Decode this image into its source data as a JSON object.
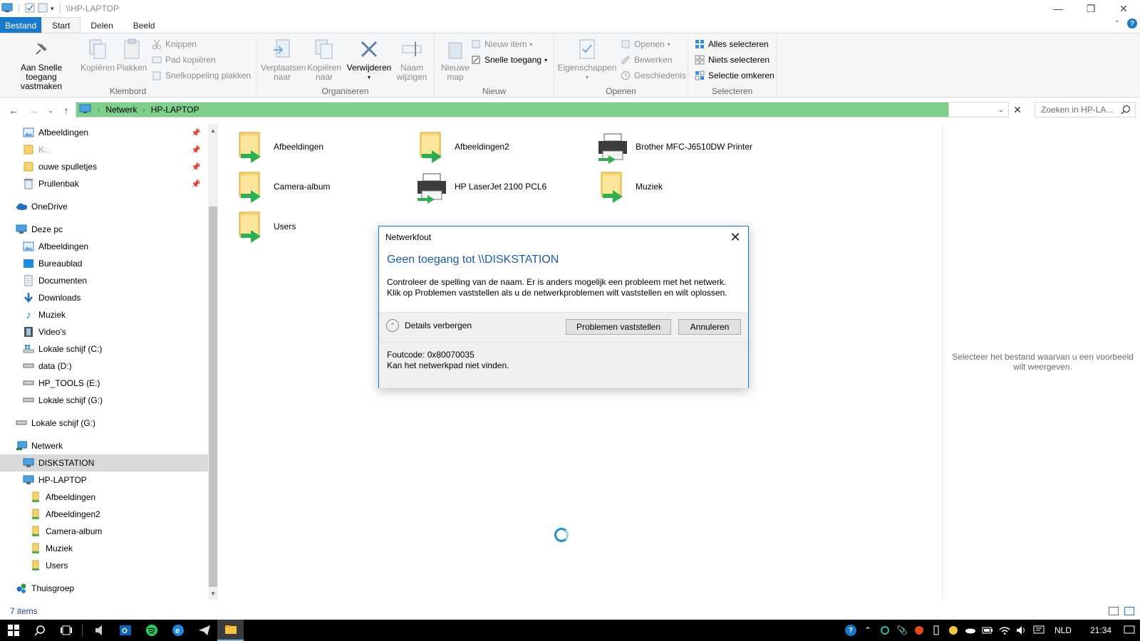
{
  "window": {
    "title": "\\\\HP-LAPTOP"
  },
  "tabs": {
    "file": "Bestand",
    "start": "Start",
    "share": "Delen",
    "view": "Beeld"
  },
  "ribbon": {
    "klembord": {
      "label": "Klembord",
      "pin_line1": "Aan Snelle toegang",
      "pin_line2": "vastmaken",
      "copy": "Kopiëren",
      "paste": "Plakken",
      "cut": "Knippen",
      "copy_path": "Pad kopiëren",
      "paste_shortcut": "Snelkoppeling plakken"
    },
    "organiseren": {
      "label": "Organiseren",
      "move_line1": "Verplaatsen",
      "move_line2": "naar",
      "copyto_line1": "Kopiëren",
      "copyto_line2": "naar",
      "delete": "Verwijderen",
      "rename_line1": "Naam",
      "rename_line2": "wijzigen"
    },
    "nieuw": {
      "label": "Nieuw",
      "newfolder_line1": "Nieuwe",
      "newfolder_line2": "map",
      "new_item": "Nieuw item",
      "easy_access": "Snelle toegang"
    },
    "openen": {
      "label": "Openen",
      "properties": "Eigenschappen",
      "open": "Openen",
      "edit": "Bewerken",
      "history": "Geschiedenis"
    },
    "selecteren": {
      "label": "Selecteren",
      "select_all": "Alles selecteren",
      "select_none": "Niets selecteren",
      "invert": "Selectie omkeren"
    }
  },
  "address": {
    "crumbs": [
      "Netwerk",
      "HP-LAPTOP"
    ],
    "search_placeholder": "Zoeken in HP-LA..."
  },
  "nav": {
    "items": [
      {
        "label": "Afbeeldingen",
        "pinned": true
      },
      {
        "label": "K...",
        "pinned": true
      },
      {
        "label": "ouwe spulletjes",
        "pinned": true
      },
      {
        "label": "Prullenbak",
        "pinned": true
      },
      {
        "label": "OneDrive"
      },
      {
        "label": "Deze pc"
      },
      {
        "label": "Afbeeldingen"
      },
      {
        "label": "Bureaublad"
      },
      {
        "label": "Documenten"
      },
      {
        "label": "Downloads"
      },
      {
        "label": "Muziek"
      },
      {
        "label": "Video's"
      },
      {
        "label": "Lokale schijf (C:)"
      },
      {
        "label": "data (D:)"
      },
      {
        "label": "HP_TOOLS (E:)"
      },
      {
        "label": "Lokale schijf (G:)"
      },
      {
        "label": "Lokale schijf (G:)"
      },
      {
        "label": "Netwerk"
      },
      {
        "label": "DISKSTATION",
        "selected": true
      },
      {
        "label": "HP-LAPTOP"
      },
      {
        "label": "Afbeeldingen"
      },
      {
        "label": "Afbeeldingen2"
      },
      {
        "label": "Camera-album"
      },
      {
        "label": "Muziek"
      },
      {
        "label": "Users"
      },
      {
        "label": "Thuisgroep"
      }
    ]
  },
  "content": {
    "items": [
      {
        "label": "Afbeeldingen",
        "type": "share"
      },
      {
        "label": "Afbeeldingen2",
        "type": "share"
      },
      {
        "label": "Brother MFC-J6510DW Printer",
        "type": "printer"
      },
      {
        "label": "Camera-album",
        "type": "share"
      },
      {
        "label": "HP LaserJet 2100 PCL6",
        "type": "printer"
      },
      {
        "label": "Muziek",
        "type": "share"
      },
      {
        "label": "Users",
        "type": "share"
      }
    ]
  },
  "preview": {
    "text": "Selecteer het bestand waarvan u een voorbeeld wilt weergeven."
  },
  "status": {
    "count": "7 items"
  },
  "dialog": {
    "title": "Netwerkfout",
    "heading": "Geen toegang tot \\\\DISKSTATION",
    "body": "Controleer de spelling van de naam. Er is anders mogelijk een probleem met het netwerk. Klik op Problemen vaststellen als u de netwerkproblemen wilt vaststellen en wilt oplossen.",
    "details_toggle": "Details verbergen",
    "diagnose_button": "Problemen vaststellen",
    "cancel_button": "Annuleren",
    "error_code": "Foutcode: 0x80070035",
    "error_message": "Kan het netwerkpad niet vinden."
  },
  "taskbar": {
    "language": "NLD",
    "time": "21:34"
  },
  "colors": {
    "accent": "#1979ca",
    "address_bar": "#7ecf89",
    "selection": "#d9d9d9"
  }
}
